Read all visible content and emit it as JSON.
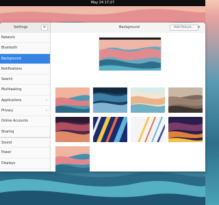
{
  "topbar": {
    "clock": "May 24  17:27"
  },
  "window": {
    "sidebar_title": "Settings",
    "main_title": "Background",
    "add_picture_label": "Add Picture…",
    "close_glyph": "×",
    "menu_glyph": "≡"
  },
  "sidebar": {
    "items": [
      {
        "label": "Network",
        "icon": "network-icon"
      },
      {
        "label": "Bluetooth",
        "icon": "bluetooth-icon"
      },
      {
        "label": "Background",
        "icon": "background-icon"
      },
      {
        "label": "Notifications",
        "icon": "bell-icon"
      },
      {
        "label": "Search",
        "icon": "search-icon"
      },
      {
        "label": "Multitasking",
        "icon": "multitasking-icon"
      },
      {
        "label": "Applications",
        "icon": "apps-icon"
      },
      {
        "label": "Privacy",
        "icon": "privacy-icon"
      },
      {
        "label": "Online Accounts",
        "icon": "accounts-icon"
      },
      {
        "label": "Sharing",
        "icon": "sharing-icon"
      },
      {
        "label": "Sound",
        "icon": "sound-icon"
      },
      {
        "label": "Power",
        "icon": "power-icon"
      },
      {
        "label": "Displays",
        "icon": "displays-icon"
      }
    ],
    "active_label": "Background"
  },
  "wallpapers": {
    "selected_preview": "current-wallpaper",
    "count": 9
  },
  "colors": {
    "accent": "#3584e4",
    "topbar": "#0f0f0f"
  }
}
